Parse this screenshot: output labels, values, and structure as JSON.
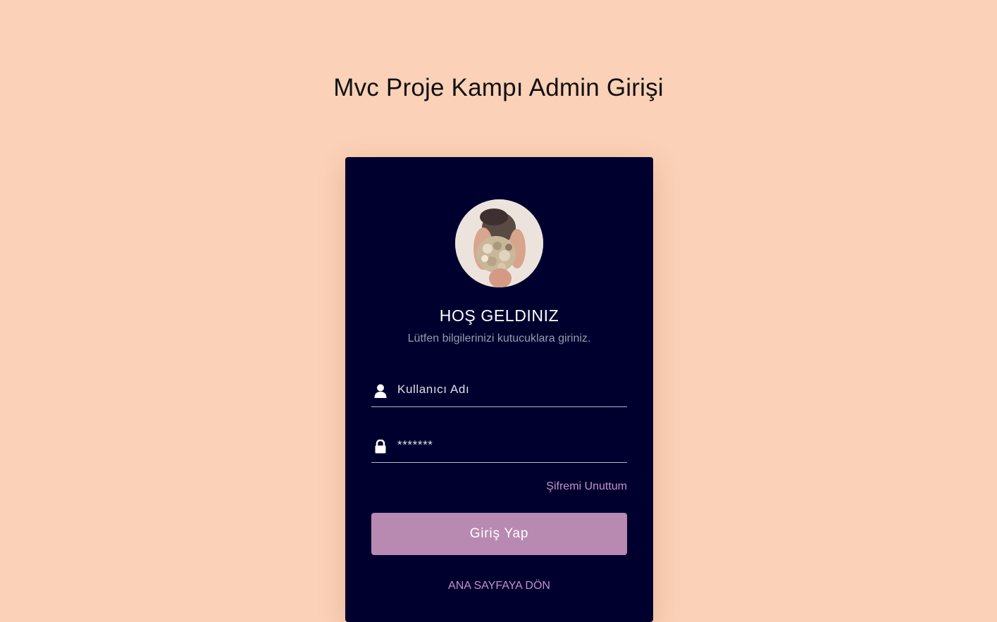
{
  "page": {
    "title": "Mvc Proje Kampı Admin Girişi",
    "background_color": "#fbd1b7"
  },
  "card": {
    "background_color": "#00002e",
    "welcome_title": "HOŞ GELDINIZ",
    "subtitle": "Lütfen bilgilerinizi kutucuklara giriniz.",
    "avatar_icon": "user-photo"
  },
  "form": {
    "username": {
      "icon": "user-icon",
      "placeholder": "Kullanıcı Adı",
      "value": ""
    },
    "password": {
      "icon": "lock-icon",
      "placeholder": "*******",
      "value": ""
    },
    "forgot_password_label": "Şifremi Unuttum",
    "submit_label": "Giriş Yap",
    "submit_color": "#b88ab1",
    "accent_color": "#c591c9"
  },
  "footer": {
    "home_link_label": "ANA SAYFAYA DÖN"
  }
}
